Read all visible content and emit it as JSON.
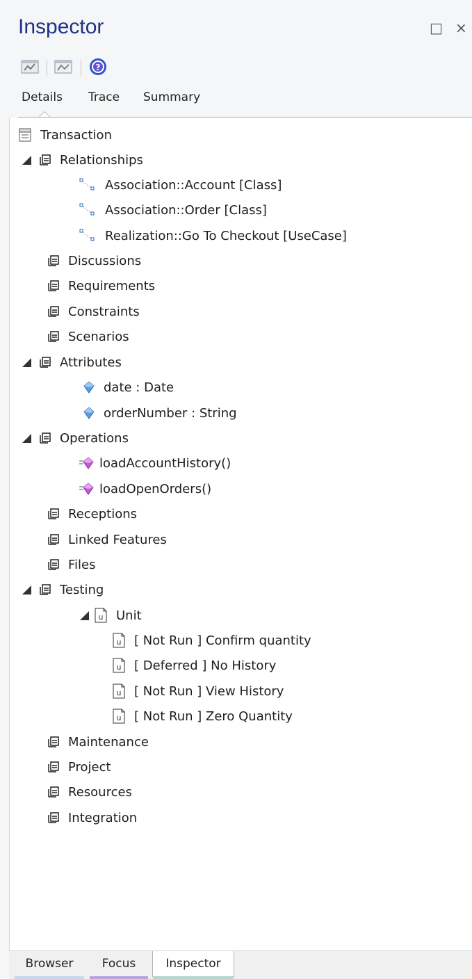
{
  "window": {
    "title": "Inspector",
    "maximize_label": "□",
    "close_label": "×"
  },
  "toolbar": {
    "buttons": [
      {
        "name": "edit-element-icon"
      },
      {
        "name": "open-properties-icon"
      },
      {
        "name": "help-icon"
      }
    ]
  },
  "top_tabs": {
    "details": "Details",
    "trace": "Trace",
    "summary": "Summary"
  },
  "tree": {
    "root": "Transaction",
    "relationships": {
      "label": "Relationships",
      "items": [
        "Association::Account [Class]",
        "Association::Order [Class]",
        "Realization::Go To Checkout [UseCase]"
      ]
    },
    "discussions": "Discussions",
    "requirements": "Requirements",
    "constraints": "Constraints",
    "scenarios": "Scenarios",
    "attributes": {
      "label": "Attributes",
      "items": [
        "date : Date",
        "orderNumber : String"
      ]
    },
    "operations": {
      "label": "Operations",
      "items": [
        "loadAccountHistory()",
        "loadOpenOrders()"
      ]
    },
    "receptions": "Receptions",
    "linked_features": "Linked Features",
    "files": "Files",
    "testing": {
      "label": "Testing",
      "unit": {
        "label": "Unit",
        "items": [
          "[ Not Run ] Confirm quantity",
          "[ Deferred ] No History",
          "[ Not Run ] View History",
          "[ Not Run ] Zero Quantity"
        ]
      }
    },
    "maintenance": "Maintenance",
    "project": "Project",
    "resources": "Resources",
    "integration": "Integration"
  },
  "bottom_tabs": {
    "browser": "Browser",
    "focus": "Focus",
    "inspector": "Inspector"
  },
  "colors": {
    "title": "#1e3287",
    "browser_tab_underline": "#c8d6ee",
    "focus_tab_underline": "#b9a3db",
    "inspector_tab_underline": "#b6d7cb"
  }
}
